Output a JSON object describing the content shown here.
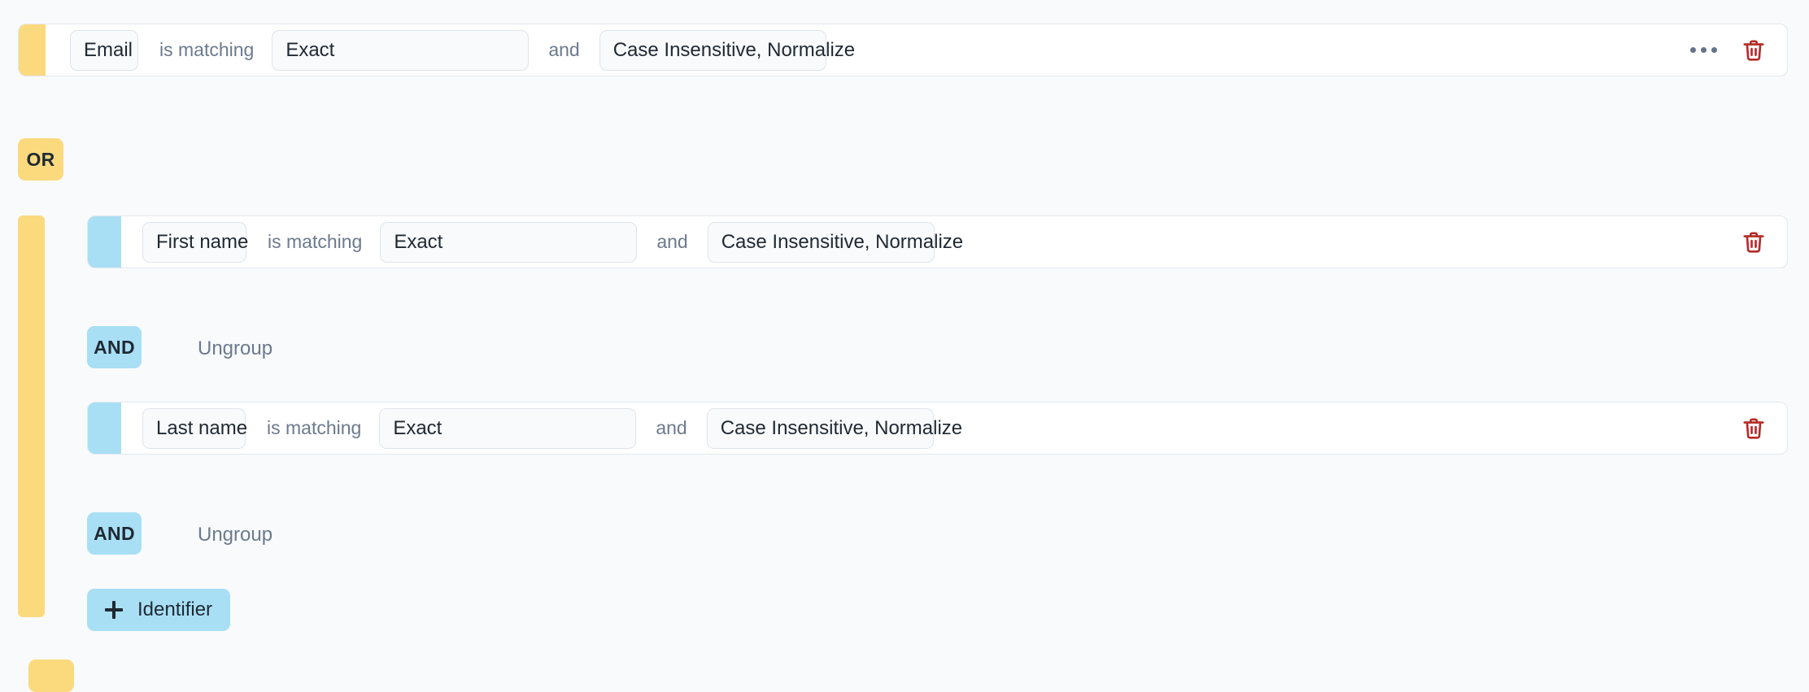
{
  "theme": {
    "background": "#f8fafc",
    "card_background": "#ffffff",
    "card_border": "#e3e8ef",
    "accent_yellow": "#fbda7e",
    "accent_blue": "#a8dff5",
    "chip_background": "#f9fafb",
    "chip_border": "#dfe4ec",
    "text_primary": "#1f2933",
    "text_muted": "#6c7a8d",
    "danger": "#b32b25"
  },
  "rules": {
    "row_email": {
      "field": "Email",
      "operator_label": "is matching",
      "match_type": "Exact",
      "conjunction_label": "and",
      "transform": "Case Insensitive, Normalize",
      "more_icon": "ellipsis-icon",
      "delete_icon": "trash-icon"
    },
    "group_operator": "OR",
    "group": {
      "row_first_name": {
        "field": "First name",
        "operator_label": "is matching",
        "match_type": "Exact",
        "conjunction_label": "and",
        "transform": "Case Insensitive, Normalize",
        "delete_icon": "trash-icon"
      },
      "operator_1": "AND",
      "ungroup_1": "Ungroup",
      "row_last_name": {
        "field": "Last name",
        "operator_label": "is matching",
        "match_type": "Exact",
        "conjunction_label": "and",
        "transform": "Case Insensitive, Normalize",
        "delete_icon": "trash-icon"
      },
      "operator_2": "AND",
      "ungroup_2": "Ungroup",
      "add_identifier": "Identifier",
      "add_icon": "plus-icon"
    }
  }
}
